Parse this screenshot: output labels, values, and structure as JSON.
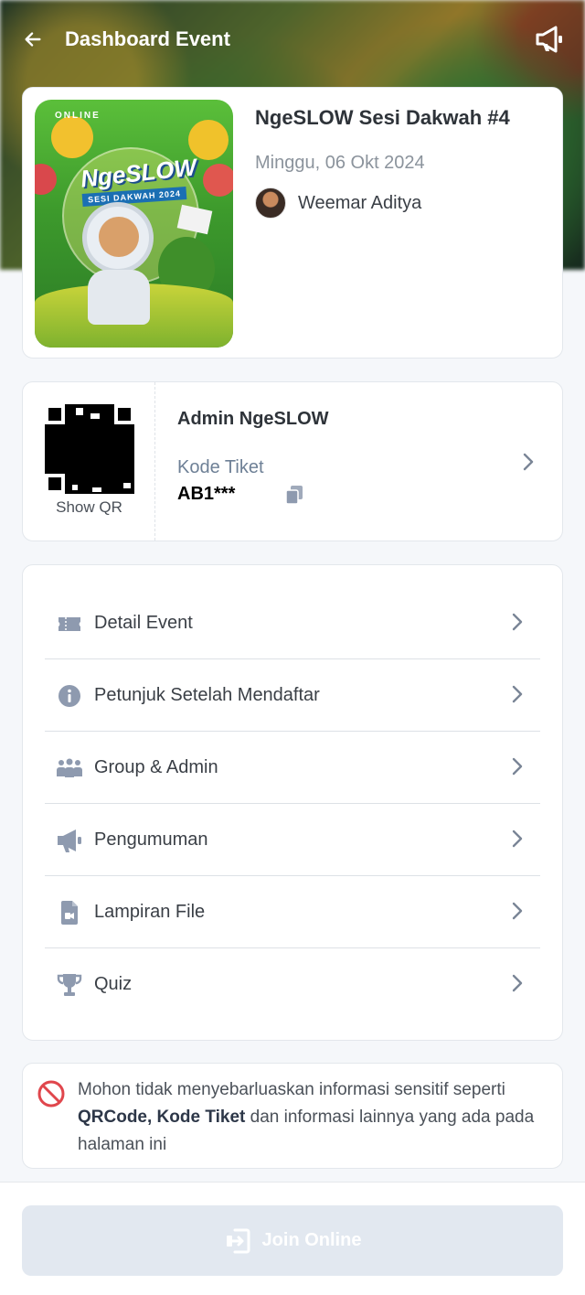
{
  "header": {
    "title": "Dashboard Event",
    "back_icon": "arrow-left-icon",
    "announce_icon": "megaphone-icon"
  },
  "event": {
    "title": "NgeSLOW Sesi Dakwah #4",
    "date": "Minggu, 06 Okt 2024",
    "host_name": "Weemar Aditya",
    "poster": {
      "badge": "ONLINE",
      "logo": "NgeSLOW",
      "subtitle": "SESI DAKWAH 2024"
    }
  },
  "ticket": {
    "show_qr_label": "Show QR",
    "admin_name": "Admin NgeSLOW",
    "code_label": "Kode Tiket",
    "code_value": "AB1***"
  },
  "menu": {
    "items": [
      {
        "label": "Detail Event",
        "icon": "ticket-icon"
      },
      {
        "label": "Petunjuk Setelah Mendaftar",
        "icon": "info-icon"
      },
      {
        "label": "Group & Admin",
        "icon": "users-icon"
      },
      {
        "label": "Pengumuman",
        "icon": "megaphone-icon"
      },
      {
        "label": "Lampiran File",
        "icon": "file-icon"
      },
      {
        "label": "Quiz",
        "icon": "trophy-icon"
      }
    ]
  },
  "warning": {
    "text_before": "Mohon tidak menyebarluaskan informasi sensitif seperti ",
    "bold": "QRCode, Kode Tiket",
    "text_after": " dan informasi lainnya yang ada pada halaman ini"
  },
  "footer": {
    "join_label": "Join Online"
  },
  "colors": {
    "menu_icon": "#8e9aaf",
    "warning_icon": "#e0464c",
    "join_disabled_bg": "#e2e8f0"
  }
}
